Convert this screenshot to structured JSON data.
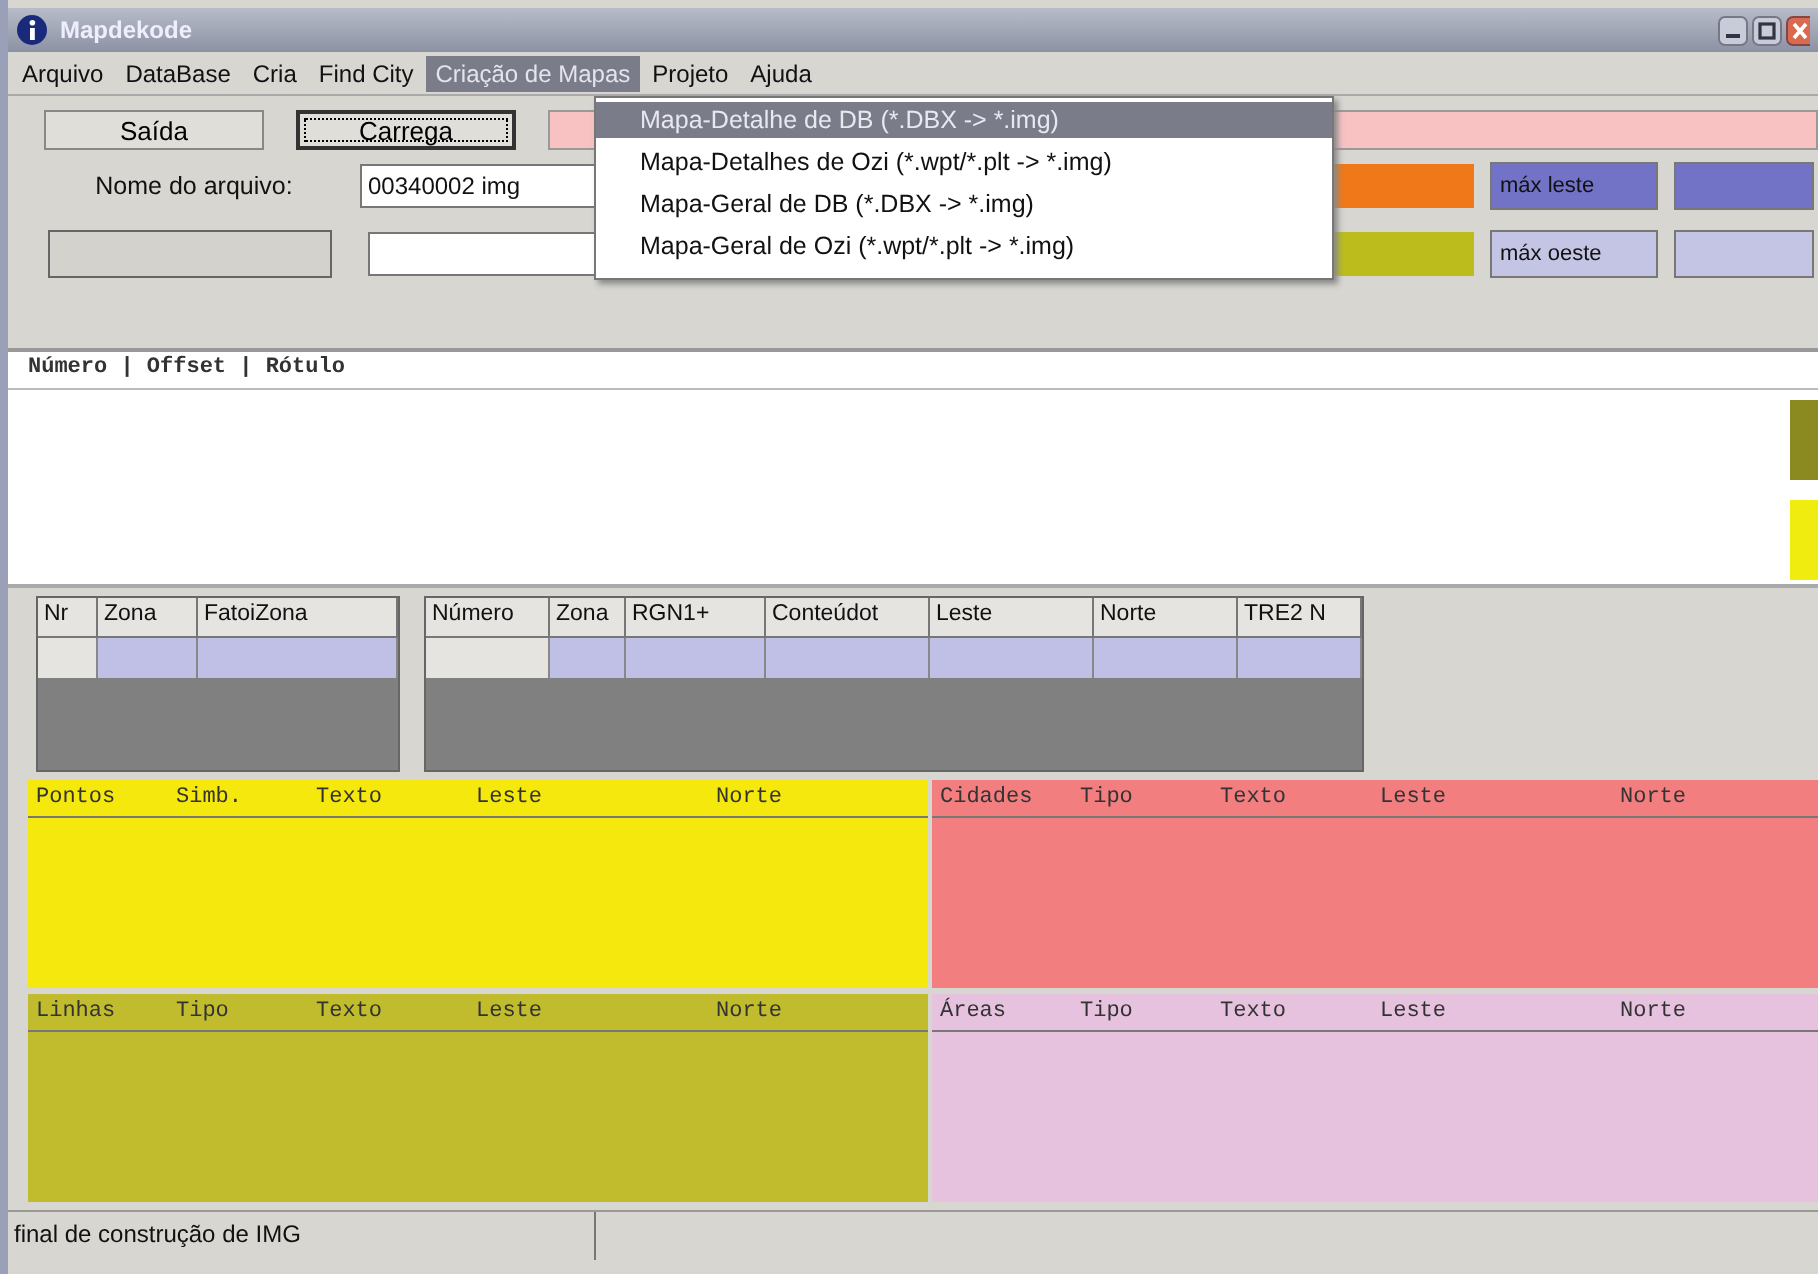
{
  "window": {
    "title": "Mapdekode"
  },
  "menu": [
    {
      "label": "Arquivo",
      "selected": false
    },
    {
      "label": "DataBase",
      "selected": false
    },
    {
      "label": "Cria",
      "selected": false
    },
    {
      "label": "Find City",
      "selected": false
    },
    {
      "label": "Criação de Mapas",
      "selected": true
    },
    {
      "label": "Projeto",
      "selected": false
    },
    {
      "label": "Ajuda",
      "selected": false
    }
  ],
  "dropdown": [
    {
      "label": "Mapa-Detalhe de DB (*.DBX -> *.img)",
      "selected": true
    },
    {
      "label": "Mapa-Detalhes de Ozi (*.wpt/*.plt -> *.img)",
      "selected": false
    },
    {
      "label": "Mapa-Geral de DB (*.DBX -> *.img)",
      "selected": false
    },
    {
      "label": "Mapa-Geral de Ozi (*.wpt/*.plt -> *.img)",
      "selected": false
    }
  ],
  "buttons": [
    {
      "label": "Saída",
      "focused": false
    },
    {
      "label": "Carrega",
      "focused": true
    }
  ],
  "file_label": "Nome do arquivo:",
  "file_value": "00340002 img",
  "rows": [
    {
      "swatch": {
        "color": "#f07818"
      },
      "label": "máx leste",
      "color": "#7272c6"
    },
    {
      "swatch": {
        "color": "#bcbc1c"
      },
      "label": "máx oeste",
      "color": "#c4c4e4"
    }
  ],
  "list_header": "Número | Offset | Rótulo",
  "tables": [
    {
      "columns": [
        "Nr",
        "Zona",
        "FatoiZona"
      ]
    },
    {
      "columns": [
        "Número",
        "Zona",
        "RGN1+",
        "Conteúdot",
        "Leste",
        "Norte",
        "TRE2 N"
      ]
    }
  ],
  "panels": [
    {
      "columns": [
        "Pontos",
        "Simb.",
        "Texto",
        "Leste",
        "Norte"
      ],
      "color": "#f4e80c"
    },
    {
      "columns": [
        "Cidades",
        "Tipo",
        "Texto",
        "Leste",
        "Norte"
      ],
      "color": "#f27e80"
    },
    {
      "columns": [
        "Linhas",
        "Tipo",
        "Texto",
        "Leste",
        "Norte"
      ],
      "color": "#c0bc2e"
    },
    {
      "columns": [
        "Áreas",
        "Tipo",
        "Texto",
        "Leste",
        "Norte"
      ],
      "color": "#e6c2de"
    }
  ],
  "status_bar": "final de construção de IMG"
}
